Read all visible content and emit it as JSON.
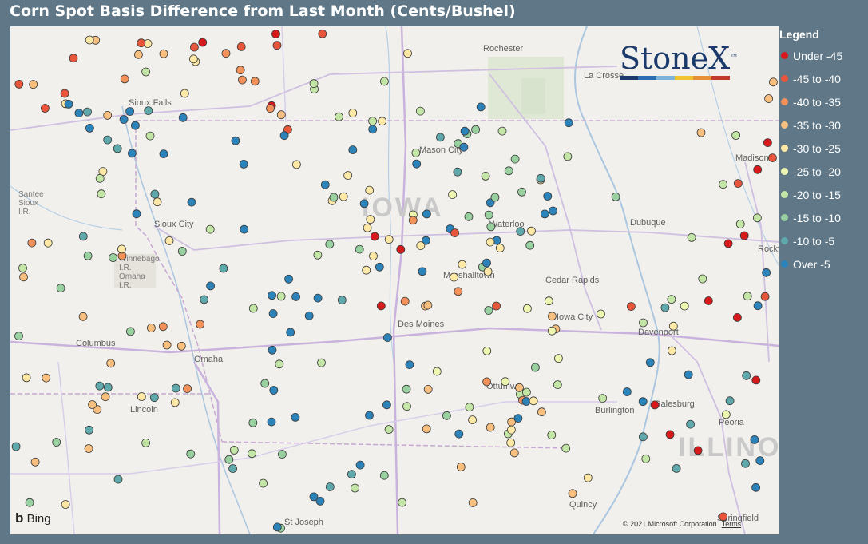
{
  "title": "Corn Spot Basis Difference from Last Month (Cents/Bushel)",
  "logo": {
    "text": "StoneX",
    "trademark": "™",
    "bar_colors": [
      "#1b3a6b",
      "#2a6db0",
      "#7fb2d9",
      "#f1c232",
      "#e69138",
      "#c0392b"
    ]
  },
  "map": {
    "cities": [
      {
        "name": "Rochester"
      },
      {
        "name": "La Crosse"
      },
      {
        "name": "Madison"
      },
      {
        "name": "Mason City"
      },
      {
        "name": "Sioux City"
      },
      {
        "name": "Waterloo"
      },
      {
        "name": "Dubuque"
      },
      {
        "name": "Marshalltown"
      },
      {
        "name": "Cedar Rapids"
      },
      {
        "name": "Iowa City"
      },
      {
        "name": "Davenport"
      },
      {
        "name": "Des Moines"
      },
      {
        "name": "Omaha"
      },
      {
        "name": "Columbus"
      },
      {
        "name": "Lincoln"
      },
      {
        "name": "Ottumwa"
      },
      {
        "name": "Burlington"
      },
      {
        "name": "Galesburg"
      },
      {
        "name": "Peoria"
      },
      {
        "name": "Quincy"
      },
      {
        "name": "St Joseph"
      },
      {
        "name": "Springfield"
      },
      {
        "name": "Rockford"
      },
      {
        "name": "Sioux Falls"
      }
    ],
    "states": [
      {
        "name": "IOWA"
      },
      {
        "name": "ILLINOIS"
      }
    ],
    "reservations": [
      "Santee\nSioux\nI.R.",
      "Winnebago\nI.R.\nOmaha\nI.R."
    ],
    "attribution": {
      "bing": "Bing",
      "copyright": "© 2021 Microsoft Corporation",
      "terms": "Terms"
    }
  },
  "legend": {
    "title": "Legend",
    "items": [
      {
        "label": "Under -45",
        "color": "#d7191c"
      },
      {
        "label": "-45 to -40",
        "color": "#e8553b"
      },
      {
        "label": "-40 to -35",
        "color": "#f2915a"
      },
      {
        "label": "-35 to -30",
        "color": "#f8bf7f"
      },
      {
        "label": "-30 to -25",
        "color": "#fde8a6"
      },
      {
        "label": "-25 to -20",
        "color": "#eef5b0"
      },
      {
        "label": "-20 to -15",
        "color": "#c3e5a6"
      },
      {
        "label": "-15 to -10",
        "color": "#98d0a0"
      },
      {
        "label": "-10 to -5",
        "color": "#5fa9ad"
      },
      {
        "label": "Over -5",
        "color": "#2b83ba"
      }
    ]
  }
}
